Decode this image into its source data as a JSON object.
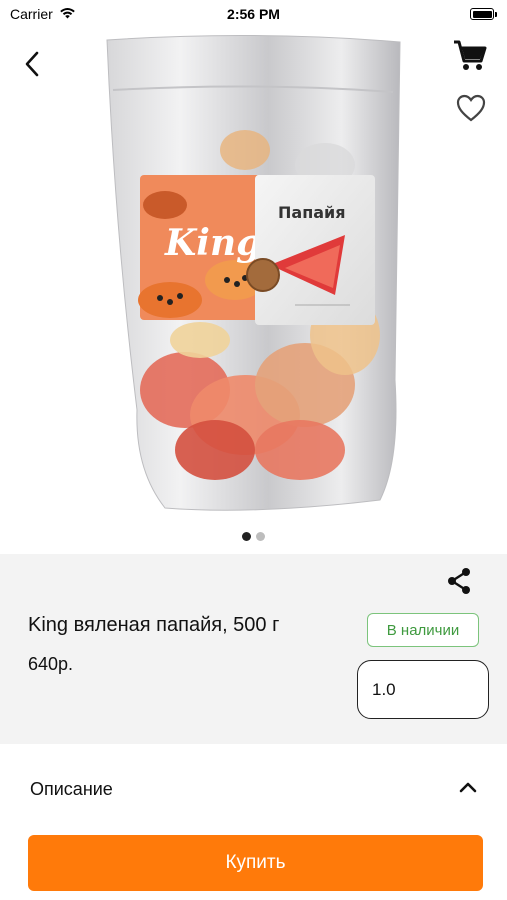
{
  "status_bar": {
    "carrier": "Carrier",
    "time": "2:56 PM"
  },
  "product": {
    "title": "King вяленая папайя, 500 г",
    "price": "640р.",
    "stock_status": "В наличии",
    "quantity": "1.0",
    "image": {
      "brand_logo_text": "King",
      "package_label": "Папайя"
    },
    "gallery": {
      "total": 2,
      "active_index": 0
    }
  },
  "description": {
    "label": "Описание"
  },
  "actions": {
    "buy_label": "Купить"
  },
  "icons": {
    "back": "chevron-left-icon",
    "cart": "cart-icon",
    "favorite": "heart-outline-icon",
    "share": "share-icon",
    "collapse": "chevron-up-icon"
  },
  "colors": {
    "accent": "#ff7a0a",
    "in_stock": "#3f9a3f",
    "panel_bg": "#f3f3f3"
  }
}
